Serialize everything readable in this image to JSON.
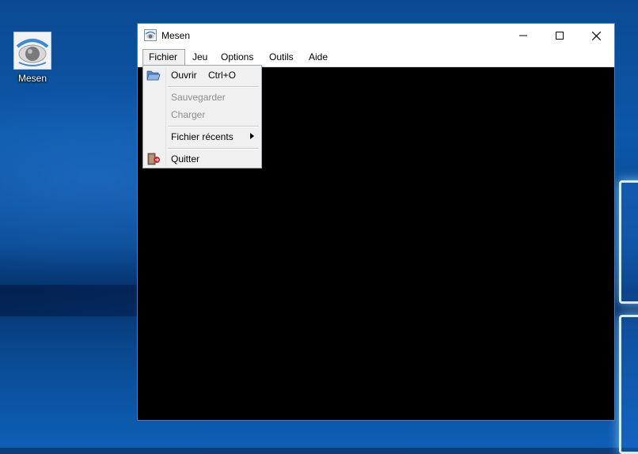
{
  "desktop": {
    "icon_label": "Mesen",
    "icon_name": "mesen-eye-icon"
  },
  "window": {
    "title": "Mesen",
    "app_icon": "mesen-eye-icon",
    "controls": {
      "minimize": "minimize-icon",
      "maximize": "maximize-icon",
      "close": "close-icon"
    }
  },
  "menubar": {
    "items": [
      {
        "label": "Fichier",
        "active": true
      },
      {
        "label": "Jeu"
      },
      {
        "label": "Options"
      },
      {
        "label": "Outils"
      },
      {
        "label": "Aide"
      }
    ]
  },
  "file_menu": {
    "open": {
      "label": "Ouvrir",
      "shortcut": "Ctrl+O",
      "icon": "folder-open-icon"
    },
    "save": {
      "label": "Sauvegarder",
      "disabled": true
    },
    "load": {
      "label": "Charger",
      "disabled": true
    },
    "recent": {
      "label": "Fichier récents",
      "icon": "submenu-arrow-icon"
    },
    "quit": {
      "label": "Quitter",
      "icon": "exit-icon"
    }
  },
  "colors": {
    "window_border": "#3b7fd0",
    "menu_bg": "#f0f0f0",
    "disabled_text": "#8d8d8d",
    "screen": "#000000"
  }
}
